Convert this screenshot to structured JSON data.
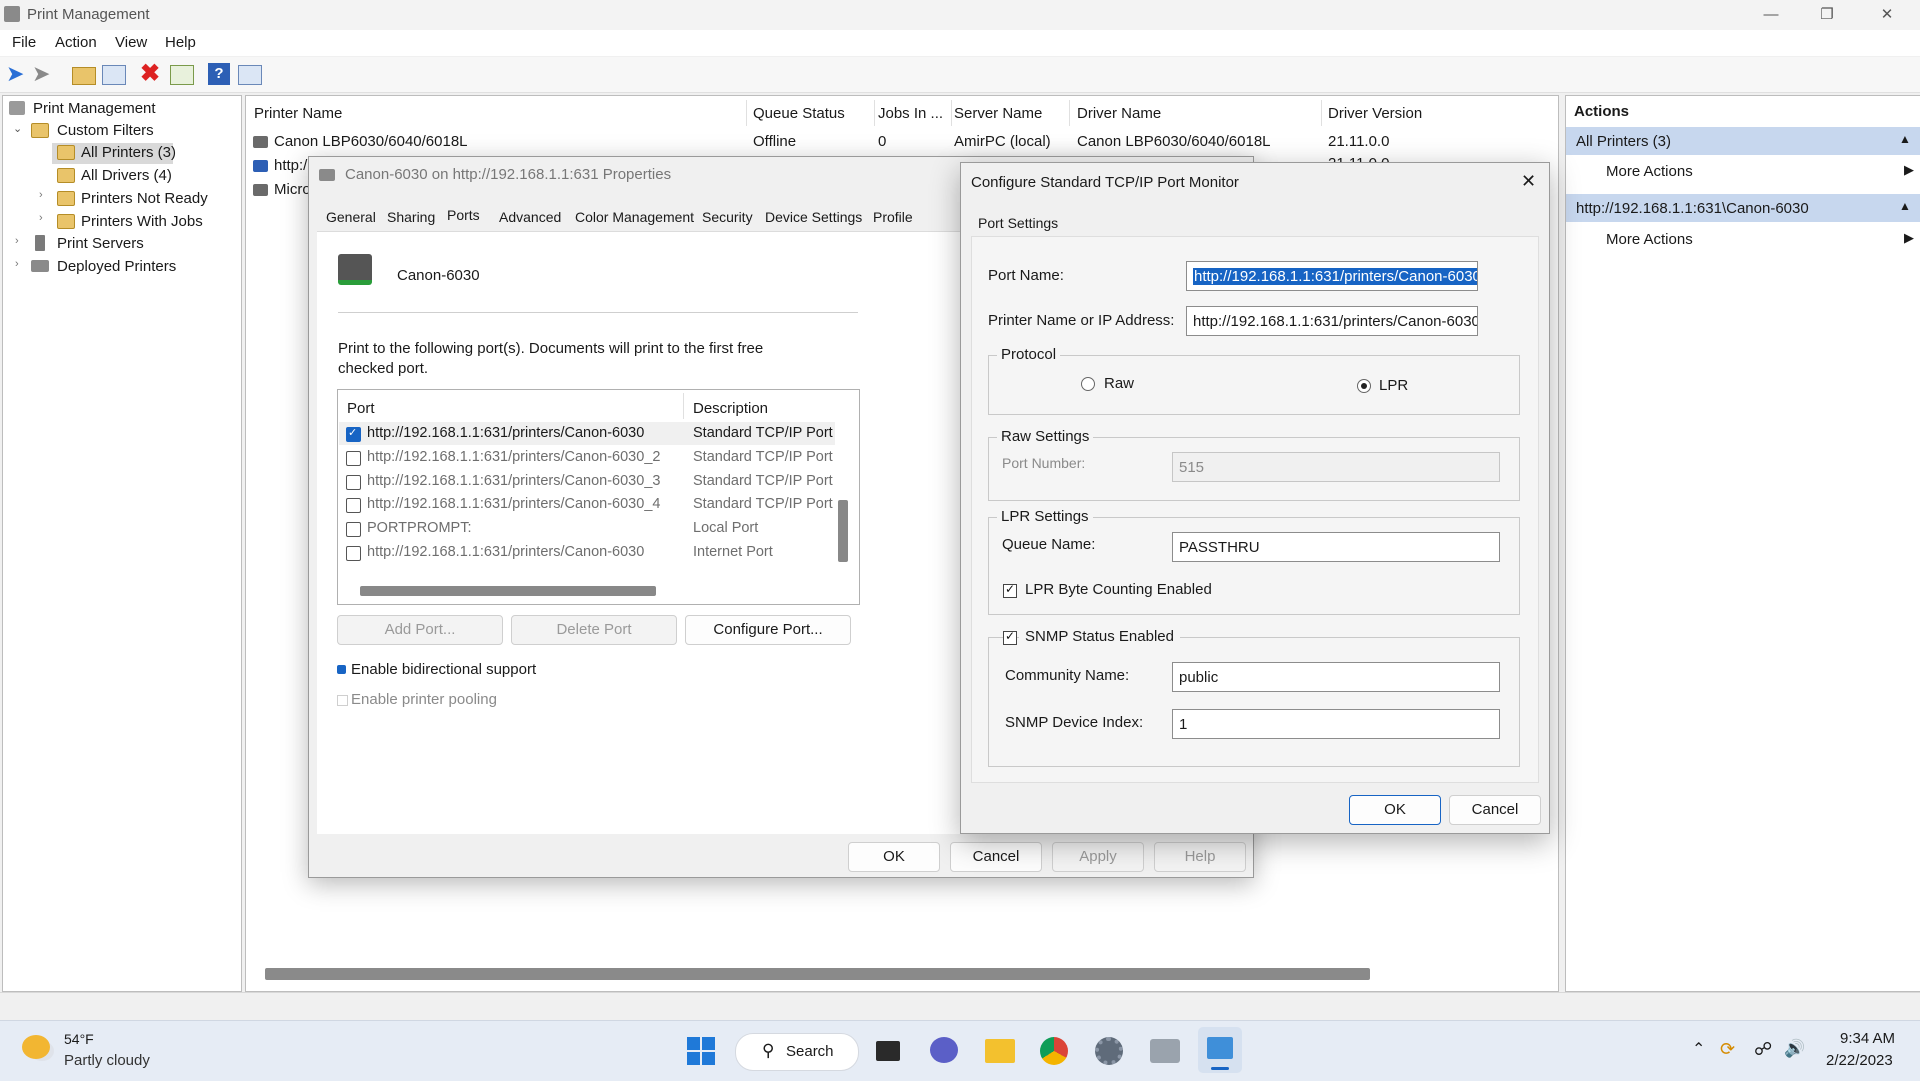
{
  "window": {
    "title": "Print Management"
  },
  "menu": [
    "File",
    "Action",
    "View",
    "Help"
  ],
  "tree": {
    "root": "Print Management",
    "custom_filters": "Custom Filters",
    "all_printers": "All Printers (3)",
    "all_drivers": "All Drivers (4)",
    "printers_not_ready": "Printers Not Ready",
    "printers_with_jobs": "Printers With Jobs",
    "print_servers": "Print Servers",
    "deployed_printers": "Deployed Printers"
  },
  "list": {
    "columns": [
      "Printer Name",
      "Queue Status",
      "Jobs In ...",
      "Server Name",
      "Driver Name",
      "Driver Version"
    ],
    "rows": [
      [
        "Canon LBP6030/6040/6018L",
        "Offline",
        "0",
        "AmirPC (local)",
        "Canon LBP6030/6040/6018L",
        "21.11.0.0"
      ],
      [
        "http:/",
        "",
        "",
        "",
        "",
        "21.11.0.0"
      ],
      [
        "Micro",
        "",
        "",
        "",
        "",
        ""
      ]
    ]
  },
  "actions": {
    "header": "Actions",
    "section1": "All Printers (3)",
    "more1": "More Actions",
    "section2": "http://192.168.1.1:631\\Canon-6030",
    "more2": "More Actions"
  },
  "props": {
    "title": "Canon-6030 on http://192.168.1.1:631 Properties",
    "tabs": [
      "General",
      "Sharing",
      "Ports",
      "Advanced",
      "Color Management",
      "Security",
      "Device Settings",
      "Profile"
    ],
    "printer_name": "Canon-6030",
    "instruction": "Print to the following port(s). Documents will print to the first free checked port.",
    "port_col": "Port",
    "desc_col": "Description",
    "ports": [
      {
        "port": "http://192.168.1.1:631/printers/Canon-6030",
        "desc": "Standard TCP/IP Port",
        "checked": true
      },
      {
        "port": "http://192.168.1.1:631/printers/Canon-6030_2",
        "desc": "Standard TCP/IP Port",
        "checked": false
      },
      {
        "port": "http://192.168.1.1:631/printers/Canon-6030_3",
        "desc": "Standard TCP/IP Port",
        "checked": false
      },
      {
        "port": "http://192.168.1.1:631/printers/Canon-6030_4",
        "desc": "Standard TCP/IP Port",
        "checked": false
      },
      {
        "port": "PORTPROMPT:",
        "desc": "Local Port",
        "checked": false
      },
      {
        "port": "http://192.168.1.1:631/printers/Canon-6030",
        "desc": "Internet Port",
        "checked": false
      }
    ],
    "add_port": "Add Port...",
    "delete_port": "Delete Port",
    "configure_port": "Configure Port...",
    "bidi": "Enable bidirectional support",
    "pooling": "Enable printer pooling",
    "ok": "OK",
    "cancel": "Cancel",
    "apply": "Apply",
    "help": "Help"
  },
  "tcp": {
    "title": "Configure Standard TCP/IP Port Monitor",
    "tab": "Port Settings",
    "port_name_label": "Port Name:",
    "port_name": "http://192.168.1.1:631/printers/Canon-6030",
    "ip_label": "Printer Name or IP Address:",
    "ip": "http://192.168.1.1:631/printers/Canon-6030",
    "protocol": "Protocol",
    "raw": "Raw",
    "lpr": "LPR",
    "raw_settings": "Raw Settings",
    "port_number_label": "Port Number:",
    "port_number": "515",
    "lpr_settings": "LPR Settings",
    "queue_label": "Queue Name:",
    "queue": "PASSTHRU",
    "byte_counting": "LPR Byte Counting Enabled",
    "snmp": "SNMP Status Enabled",
    "community_label": "Community Name:",
    "community": "public",
    "index_label": "SNMP Device Index:",
    "index": "1",
    "ok": "OK",
    "cancel": "Cancel"
  },
  "taskbar": {
    "temp": "54°F",
    "weather": "Partly cloudy",
    "search": "Search",
    "time": "9:34 AM",
    "date": "2/22/2023"
  },
  "colors": {
    "accent": "#1764c4",
    "selection": "#c7d7ee"
  }
}
